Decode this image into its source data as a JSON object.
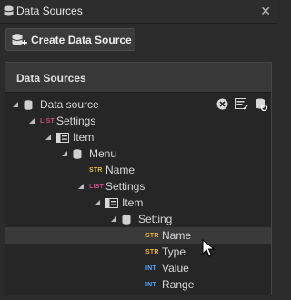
{
  "window": {
    "title": "Data Sources",
    "close_glyph": "✕"
  },
  "toolbar": {
    "create_label": "Create Data Source"
  },
  "panel": {
    "title": "Data Sources"
  },
  "tree": [
    {
      "label": "Data source",
      "type": "",
      "icon": "database-icon"
    },
    {
      "label": "Settings",
      "type": "LIST",
      "icon": ""
    },
    {
      "label": "Item",
      "type": "",
      "icon": "item-icon"
    },
    {
      "label": "Menu",
      "type": "",
      "icon": "database-icon"
    },
    {
      "label": "Name",
      "type": "STR",
      "icon": ""
    },
    {
      "label": "Settings",
      "type": "LIST",
      "icon": ""
    },
    {
      "label": "Item",
      "type": "",
      "icon": "item-icon"
    },
    {
      "label": "Setting",
      "type": "",
      "icon": "database-icon"
    },
    {
      "label": "Name",
      "type": "STR",
      "icon": ""
    },
    {
      "label": "Type",
      "type": "STR",
      "icon": ""
    },
    {
      "label": "Value",
      "type": "INT",
      "icon": ""
    },
    {
      "label": "Range",
      "type": "INT",
      "icon": ""
    }
  ],
  "colors": {
    "list": "#d24b8c",
    "str": "#e7b73a",
    "int": "#4fa3ff",
    "selected_row": "#3a3a3a"
  }
}
